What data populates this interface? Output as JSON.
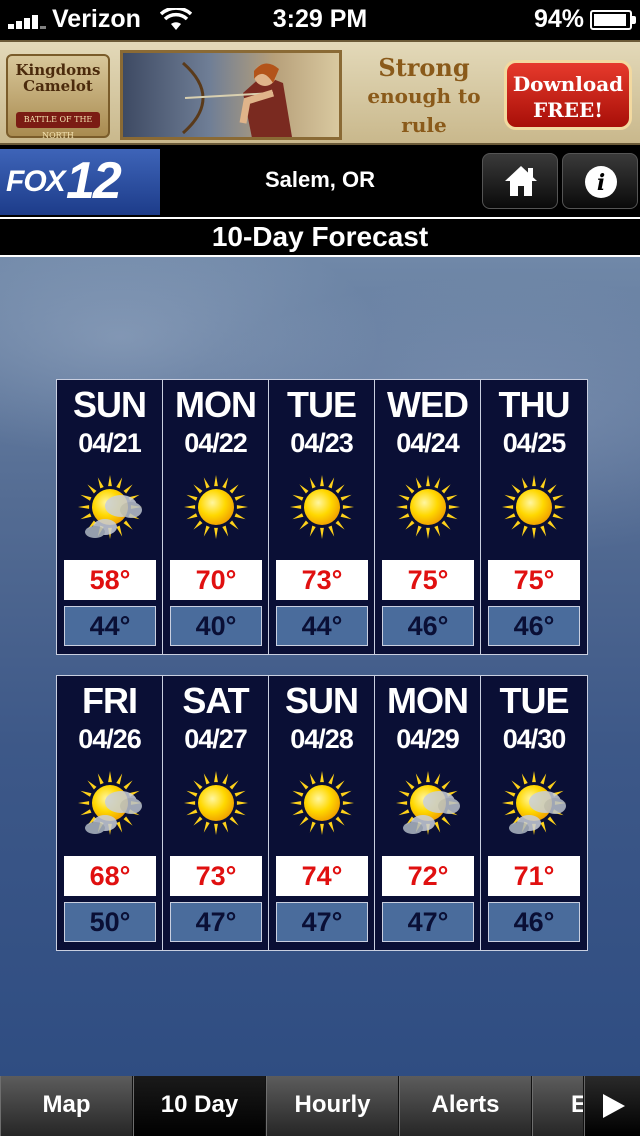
{
  "status_bar": {
    "carrier": "Verizon",
    "time": "3:29 PM",
    "battery_percent": "94%",
    "battery_level": 0.94
  },
  "ad": {
    "logo_text": "Kingdoms\nCamelot",
    "logo_ribbon": "BATTLE OF THE NORTH",
    "tagline_line1": "Strong",
    "tagline_line2": "enough to",
    "tagline_line3": "rule Camelot?",
    "button_label": "Download\nFREE!"
  },
  "header": {
    "logo_fox": "FOX",
    "logo_number": "12",
    "location": "Salem, OR",
    "home_icon": "home-icon",
    "info_icon": "info-icon"
  },
  "title": "10-Day Forecast",
  "forecast": {
    "days": [
      {
        "day": "SUN",
        "date": "04/21",
        "hi": "58°",
        "lo": "44°",
        "icon": "partly-cloudy"
      },
      {
        "day": "MON",
        "date": "04/22",
        "hi": "70°",
        "lo": "40°",
        "icon": "sunny"
      },
      {
        "day": "TUE",
        "date": "04/23",
        "hi": "73°",
        "lo": "44°",
        "icon": "sunny"
      },
      {
        "day": "WED",
        "date": "04/24",
        "hi": "75°",
        "lo": "46°",
        "icon": "sunny"
      },
      {
        "day": "THU",
        "date": "04/25",
        "hi": "75°",
        "lo": "46°",
        "icon": "sunny"
      },
      {
        "day": "FRI",
        "date": "04/26",
        "hi": "68°",
        "lo": "50°",
        "icon": "partly-cloudy"
      },
      {
        "day": "SAT",
        "date": "04/27",
        "hi": "73°",
        "lo": "47°",
        "icon": "sunny"
      },
      {
        "day": "SUN",
        "date": "04/28",
        "hi": "74°",
        "lo": "47°",
        "icon": "sunny"
      },
      {
        "day": "MON",
        "date": "04/29",
        "hi": "72°",
        "lo": "47°",
        "icon": "partly-cloudy"
      },
      {
        "day": "TUE",
        "date": "04/30",
        "hi": "71°",
        "lo": "46°",
        "icon": "partly-cloudy"
      }
    ]
  },
  "tabs": [
    {
      "label": "Map",
      "active": false
    },
    {
      "label": "10 Day",
      "active": true
    },
    {
      "label": "Hourly",
      "active": false
    },
    {
      "label": "Alerts",
      "active": false
    },
    {
      "label": "E",
      "active": false
    }
  ],
  "colors": {
    "high_temp": "#e01010",
    "low_temp_bg": "#4a6c9c",
    "card_bg": "#0a0f35"
  }
}
